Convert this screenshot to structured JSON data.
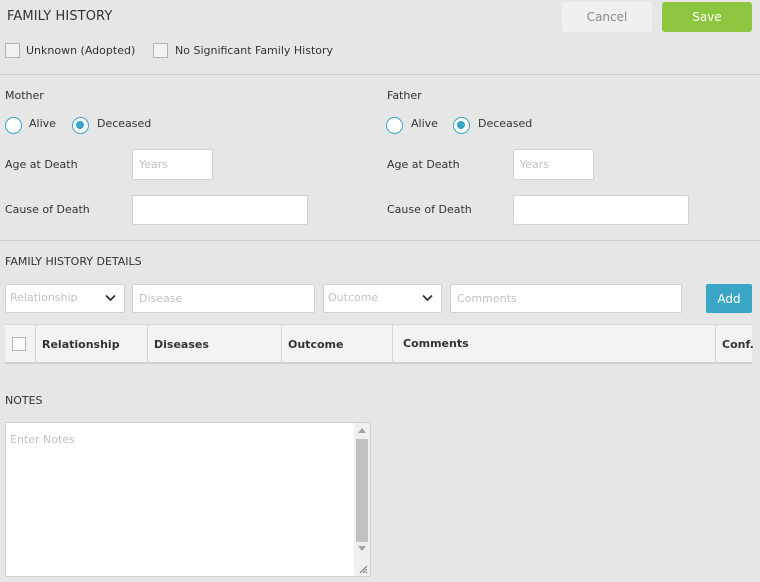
{
  "header": {
    "title": "FAMILY HISTORY",
    "cancel_label": "Cancel",
    "save_label": "Save"
  },
  "options": {
    "unknown_label": "Unknown (Adopted)",
    "no_significant_label": "No Significant Family History"
  },
  "mother": {
    "heading": "Mother",
    "alive_label": "Alive",
    "deceased_label": "Deceased",
    "status": "Deceased",
    "age_label": "Age at Death",
    "age_placeholder": "Years",
    "cause_label": "Cause of Death"
  },
  "father": {
    "heading": "Father",
    "alive_label": "Alive",
    "deceased_label": "Deceased",
    "status": "Deceased",
    "age_label": "Age at Death",
    "age_placeholder": "Years",
    "cause_label": "Cause of Death"
  },
  "details": {
    "heading": "FAMILY HISTORY DETAILS",
    "relationship_placeholder": "Relationship",
    "disease_placeholder": "Disease",
    "outcome_placeholder": "Outcome",
    "comments_placeholder": "Comments",
    "add_label": "Add",
    "columns": [
      "Relationship",
      "Diseases",
      "Outcome",
      "Comments",
      "Conf."
    ]
  },
  "notes": {
    "heading": "NOTES",
    "placeholder": "Enter Notes"
  },
  "colors": {
    "save": "#8cc63f",
    "accent": "#3aa6c6"
  }
}
